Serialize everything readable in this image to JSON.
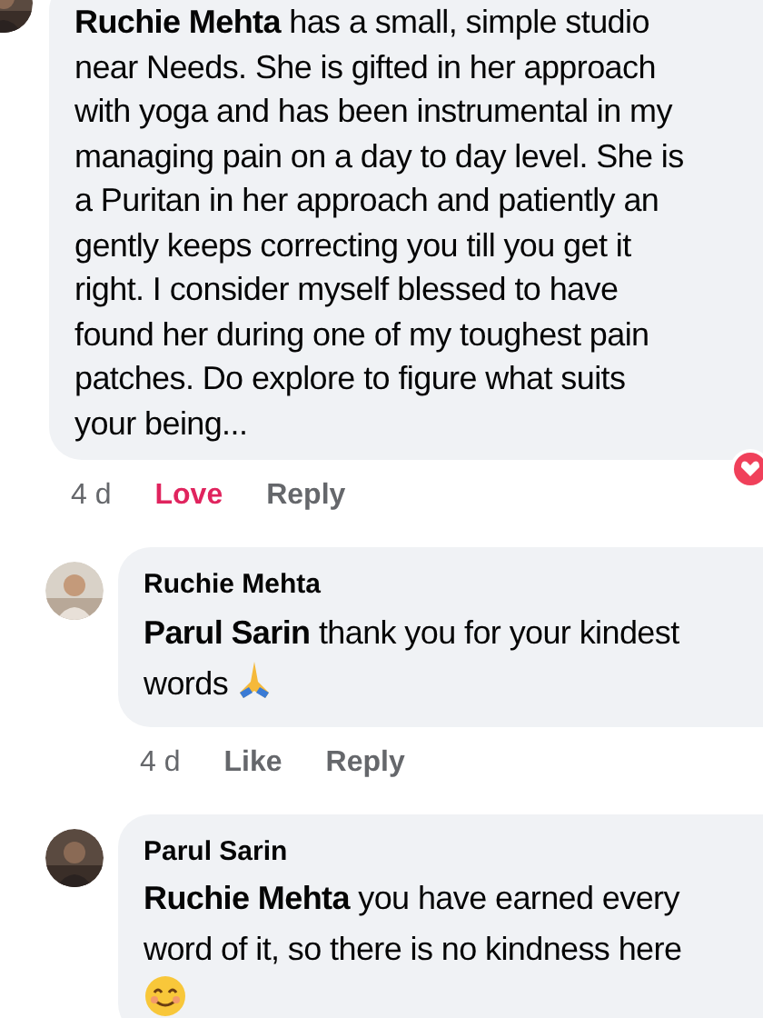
{
  "comments": [
    {
      "kind": "loved",
      "text": "**Ruchie Mehta** has a small, simple studio\nnear Needs. She is gifted in her approach\nwith yoga and has been instrumental in my\nmanaging pain on a day to day level. She is\na Puritan in her approach and patiently an\ngently keeps correcting you till you get it\nright. I consider myself blessed to have\nfound her during one of my toughest pain\npatches. Do explore to figure what suits\nyour being...",
      "time": "4 d",
      "actions": [
        {
          "label": "Love",
          "active": true
        },
        {
          "label": "Reply",
          "active": false
        }
      ],
      "replies": [
        {
          "kind": "pray",
          "author": "Ruchie Mehta",
          "text": "**Parul Sarin** thank you for your kindest\nwords",
          "time": "4 d",
          "actions": [
            {
              "label": "Like",
              "active": false
            },
            {
              "label": "Reply",
              "active": false
            }
          ]
        },
        {
          "kind": "smile",
          "author": "Parul Sarin",
          "text": "**Ruchie Mehta** you have earned every\nword of it, so there is no kindness here"
        }
      ]
    }
  ]
}
